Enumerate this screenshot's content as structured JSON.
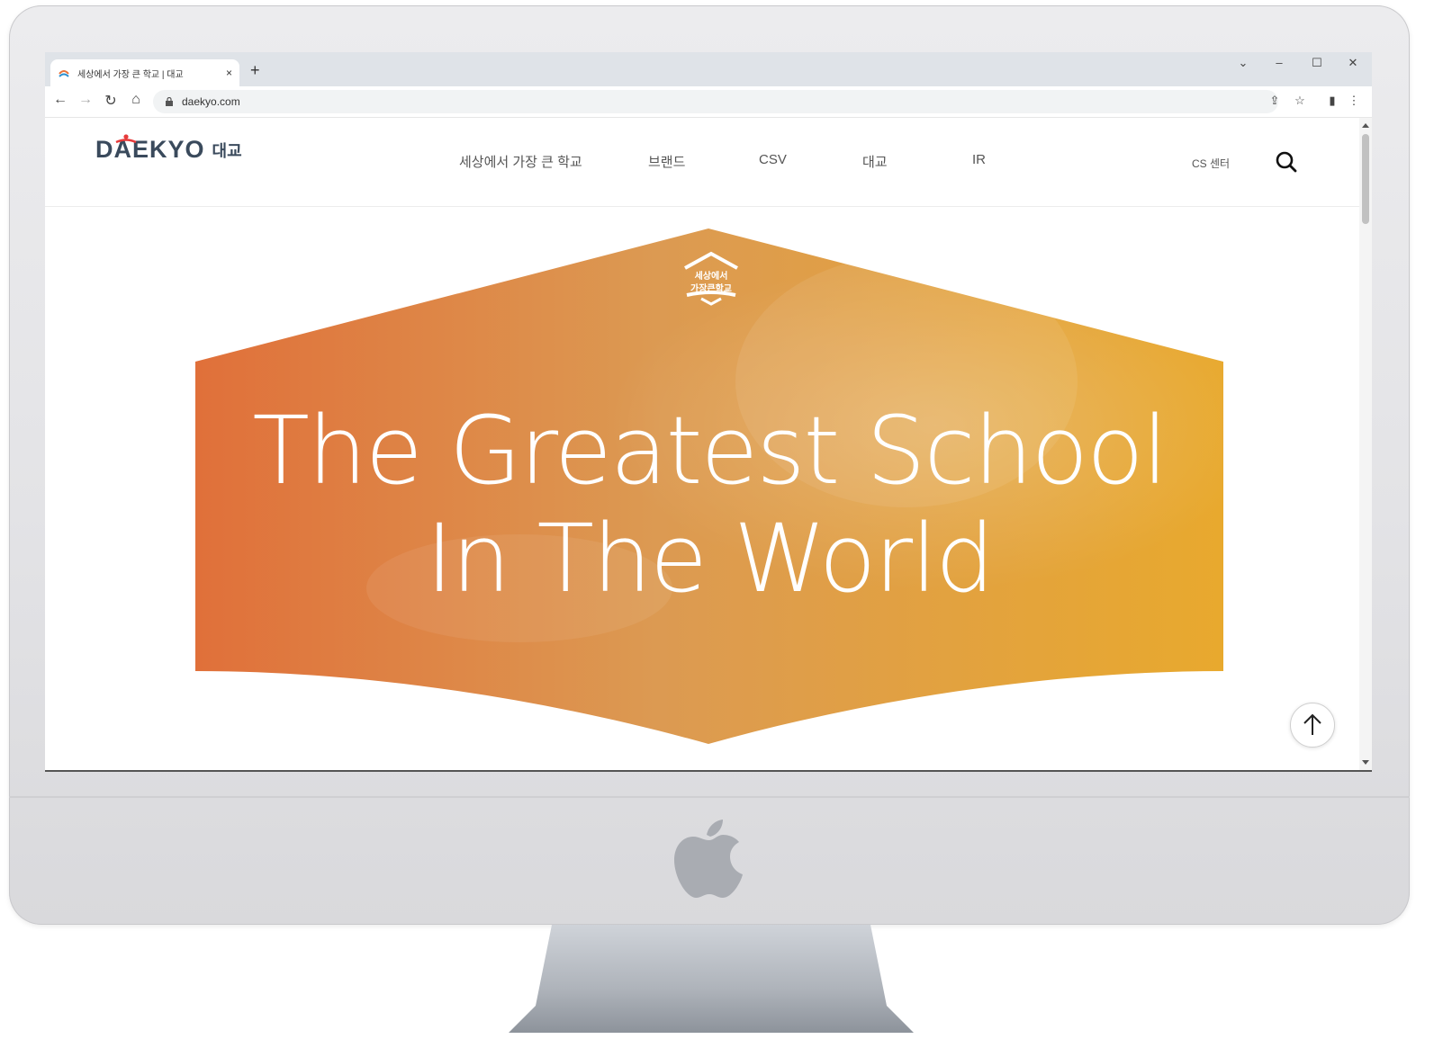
{
  "browser": {
    "tab_title": "세상에서 가장 큰 학교 | 대교",
    "tab_close": "×",
    "new_tab": "+",
    "url": "daekyo.com",
    "window_controls": {
      "minimize": "–",
      "maximize": "☐",
      "close": "✕",
      "tab_search": "⌄"
    },
    "nav": {
      "back": "←",
      "forward": "→",
      "reload": "↻",
      "home": "⌂"
    },
    "toolbar_icons": {
      "share": "⇪",
      "bookmark": "☆",
      "side_panel": "▮",
      "menu": "⋮"
    }
  },
  "site": {
    "logo_text": "DAEKYO",
    "logo_ko": "대교",
    "menu": [
      "세상에서 가장 큰 학교",
      "브랜드",
      "CSV",
      "대교",
      "IR"
    ],
    "cs_center": "CS 센터",
    "icons": {
      "search": "search-icon",
      "to_top": "arrow-up-icon"
    }
  },
  "hero": {
    "badge_line1": "세상에서",
    "badge_line2": "가장큰학교",
    "headline_line1": "The Greatest School",
    "headline_line2": "In The World",
    "gradient_colors": [
      "#e0703a",
      "#e8a531",
      "#3aa36a",
      "#2a8fd0"
    ]
  },
  "brand_colors": {
    "logo": "#3a4a5c",
    "logo_accent": "#e63b3b"
  }
}
